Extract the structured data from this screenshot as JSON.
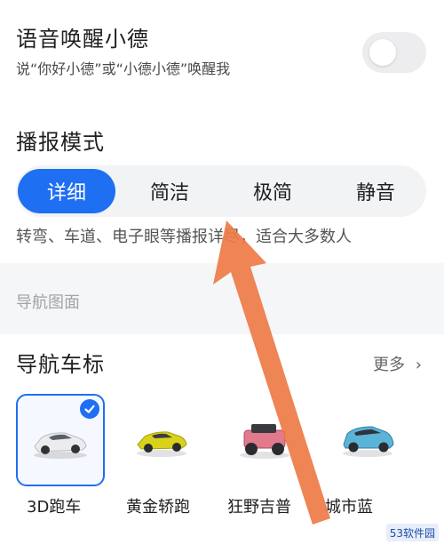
{
  "wake": {
    "title": "语音唤醒小德",
    "subtitle": "说“你好小德”或“小德小德”唤醒我",
    "toggle_on": false
  },
  "broadcast": {
    "title": "播报模式",
    "options": [
      "详细",
      "简洁",
      "极简",
      "静音"
    ],
    "selected": "详细",
    "description": "转弯、车道、电子眼等播报详尽，适合大多数人"
  },
  "section_header": "导航图面",
  "car_marker": {
    "title": "导航车标",
    "more_label": "更多",
    "cars": [
      {
        "label": "3D跑车",
        "selected": true,
        "color": "#e9e9eb"
      },
      {
        "label": "黄金轿跑",
        "selected": false,
        "color": "#d8d21a"
      },
      {
        "label": "狂野吉普",
        "selected": false,
        "color": "#e07a8c"
      },
      {
        "label": "城市蓝",
        "selected": false,
        "color": "#5bb3d8"
      }
    ]
  },
  "watermark": "53软件园",
  "colors": {
    "accent": "#1f6ff2",
    "arrow": "#ee7a45"
  }
}
